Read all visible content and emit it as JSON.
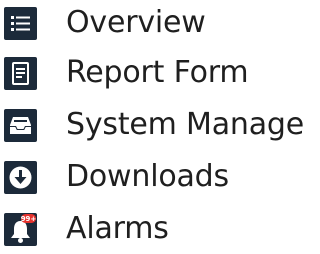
{
  "menu": {
    "items": [
      {
        "label": "Overview",
        "icon": "list-icon"
      },
      {
        "label": "Report Form",
        "icon": "form-icon"
      },
      {
        "label": "System Manage",
        "icon": "inbox-tray-icon"
      },
      {
        "label": "Downloads",
        "icon": "download-circle-icon"
      },
      {
        "label": "Alarms",
        "icon": "bell-icon",
        "badge": "99+"
      }
    ]
  },
  "colors": {
    "icon_bg": "#1c2a3a",
    "icon_fg": "#ffffff",
    "text": "#1f1f1f",
    "badge": "#e5322d"
  }
}
